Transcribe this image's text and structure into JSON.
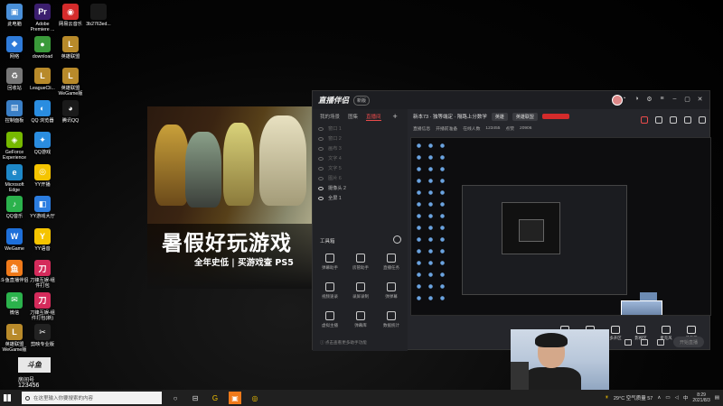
{
  "desktop_icons": [
    {
      "label": "此电脑",
      "color": "#4a90d9",
      "glyph": "▣",
      "col": 0,
      "row": 0
    },
    {
      "label": "Adobe\nPremiere ...",
      "color": "#3b1e6e",
      "glyph": "Pr",
      "col": 1,
      "row": 0
    },
    {
      "label": "网易云音乐",
      "color": "#d42b2b",
      "glyph": "◉",
      "col": 2,
      "row": 0
    },
    {
      "label": "3b2763ed...",
      "color": "#1a1a1a",
      "glyph": "",
      "col": 3,
      "row": 0
    },
    {
      "label": "网络",
      "color": "#2f7bd9",
      "glyph": "◆",
      "col": 0,
      "row": 1
    },
    {
      "label": "download",
      "color": "#3a9a3a",
      "glyph": "●",
      "col": 1,
      "row": 1
    },
    {
      "label": "英雄联盟",
      "color": "#b88a2a",
      "glyph": "L",
      "col": 2,
      "row": 1
    },
    {
      "label": "回收站",
      "color": "#777",
      "glyph": "♻",
      "col": 0,
      "row": 2
    },
    {
      "label": "LeagueCli...",
      "color": "#b88a2a",
      "glyph": "L",
      "col": 1,
      "row": 2
    },
    {
      "label": "英雄联盟\nWeGame版",
      "color": "#b88a2a",
      "glyph": "L",
      "col": 2,
      "row": 2
    },
    {
      "label": "控制面板",
      "color": "#3a7fc6",
      "glyph": "▤",
      "col": 0,
      "row": 3
    },
    {
      "label": "QQ 浏览器",
      "color": "#2a8de0",
      "glyph": "◐",
      "col": 1,
      "row": 3
    },
    {
      "label": "腾讯QQ",
      "color": "#1a1a1a",
      "glyph": "◕",
      "col": 2,
      "row": 3
    },
    {
      "label": "GeForce\nExperience",
      "color": "#76b900",
      "glyph": "◈",
      "col": 0,
      "row": 4
    },
    {
      "label": "QQ游戏",
      "color": "#2a8de0",
      "glyph": "✦",
      "col": 1,
      "row": 4
    },
    {
      "label": "Microsoft\nEdge",
      "color": "#1e88c8",
      "glyph": "e",
      "col": 0,
      "row": 5
    },
    {
      "label": "YY开播",
      "color": "#f5c400",
      "glyph": "◎",
      "col": 1,
      "row": 5
    },
    {
      "label": "QQ音乐",
      "color": "#2bb24c",
      "glyph": "♪",
      "col": 0,
      "row": 6
    },
    {
      "label": "YY游戏大厅",
      "color": "#2b7de0",
      "glyph": "◧",
      "col": 1,
      "row": 6
    },
    {
      "label": "WeGame",
      "color": "#1e6fd9",
      "glyph": "W",
      "col": 0,
      "row": 7
    },
    {
      "label": "YY语音",
      "color": "#f5c400",
      "glyph": "Y",
      "col": 1,
      "row": 7
    },
    {
      "label": "斗鱼直播伴侣",
      "color": "#f07a1a",
      "glyph": "鱼",
      "col": 0,
      "row": 8
    },
    {
      "label": "刀锋互娱-组\n件打包",
      "color": "#d42b5b",
      "glyph": "刀",
      "col": 1,
      "row": 8
    },
    {
      "label": "微信",
      "color": "#2bb24c",
      "glyph": "✉",
      "col": 0,
      "row": 9
    },
    {
      "label": "刀锋互娱-组\n件打包(新)",
      "color": "#d42b5b",
      "glyph": "刀",
      "col": 1,
      "row": 9
    },
    {
      "label": "英雄联盟\nWeGame版",
      "color": "#b88a2a",
      "glyph": "L",
      "col": 0,
      "row": 10
    },
    {
      "label": "剪映专业版",
      "color": "#222",
      "glyph": "✂",
      "col": 1,
      "row": 10
    }
  ],
  "banner": {
    "title": "暑假好玩游戏",
    "subtitle": "全年史低 | 买游戏查 PS5"
  },
  "app": {
    "logo": "直播伴侣",
    "version_badge": "新版",
    "tabs": [
      "我的场景",
      "图集",
      "直播间"
    ],
    "active_tab_index": 2,
    "tab_plus": "+",
    "scenes": [
      {
        "label": "窗口 1",
        "lit": false
      },
      {
        "label": "窗口 2",
        "lit": false
      },
      {
        "label": "画布 3",
        "lit": false
      },
      {
        "label": "文字 4",
        "lit": false
      },
      {
        "label": "文字 5",
        "lit": false
      },
      {
        "label": "图片 6",
        "lit": false
      },
      {
        "label": "摄像头 2",
        "lit": true
      },
      {
        "label": "全屏 1",
        "lit": true
      }
    ],
    "tools_heading": "工具箱",
    "tools": [
      {
        "label": "弹幕助手",
        "col": 0,
        "row": 0
      },
      {
        "label": "房管助手",
        "col": 1,
        "row": 0
      },
      {
        "label": "直播任务",
        "col": 2,
        "row": 0
      },
      {
        "label": "视频速录",
        "col": 0,
        "row": 1
      },
      {
        "label": "录屏录制",
        "col": 1,
        "row": 1
      },
      {
        "label": "弹弹幕",
        "col": 2,
        "row": 1
      },
      {
        "label": "虚拟主播",
        "col": 0,
        "row": 2
      },
      {
        "label": "弹幕库",
        "col": 1,
        "row": 2
      },
      {
        "label": "数据统计",
        "col": 2,
        "row": 2
      }
    ],
    "left_footer": "ⓘ 点击查看更多助手功能",
    "info": {
      "title": "新本73 · 独等端定 · 隔路上分数学",
      "category": "英雄",
      "game_tag": "英雄联盟",
      "red_tag": "",
      "row2_a": "直播信息",
      "row2_b": "开播前准备",
      "row2_c": "在线人数",
      "row2_d": "123455",
      "row2_e": "点赞",
      "row2_f": "20906"
    },
    "bottom_buttons": [
      "直播屏幕",
      "摄像头",
      "多开区",
      "影视区",
      "麦克风",
      "扬声器"
    ],
    "start_live": "开始直播"
  },
  "watermark": {
    "logo": "斗鱼",
    "room_label": "房间号",
    "room_number": "123456"
  },
  "taskbar": {
    "search_placeholder": "在这里输入你要搜索的内容",
    "weather": "29°C 空气质量 57",
    "time": "8:29",
    "date": "2021/8/3"
  }
}
